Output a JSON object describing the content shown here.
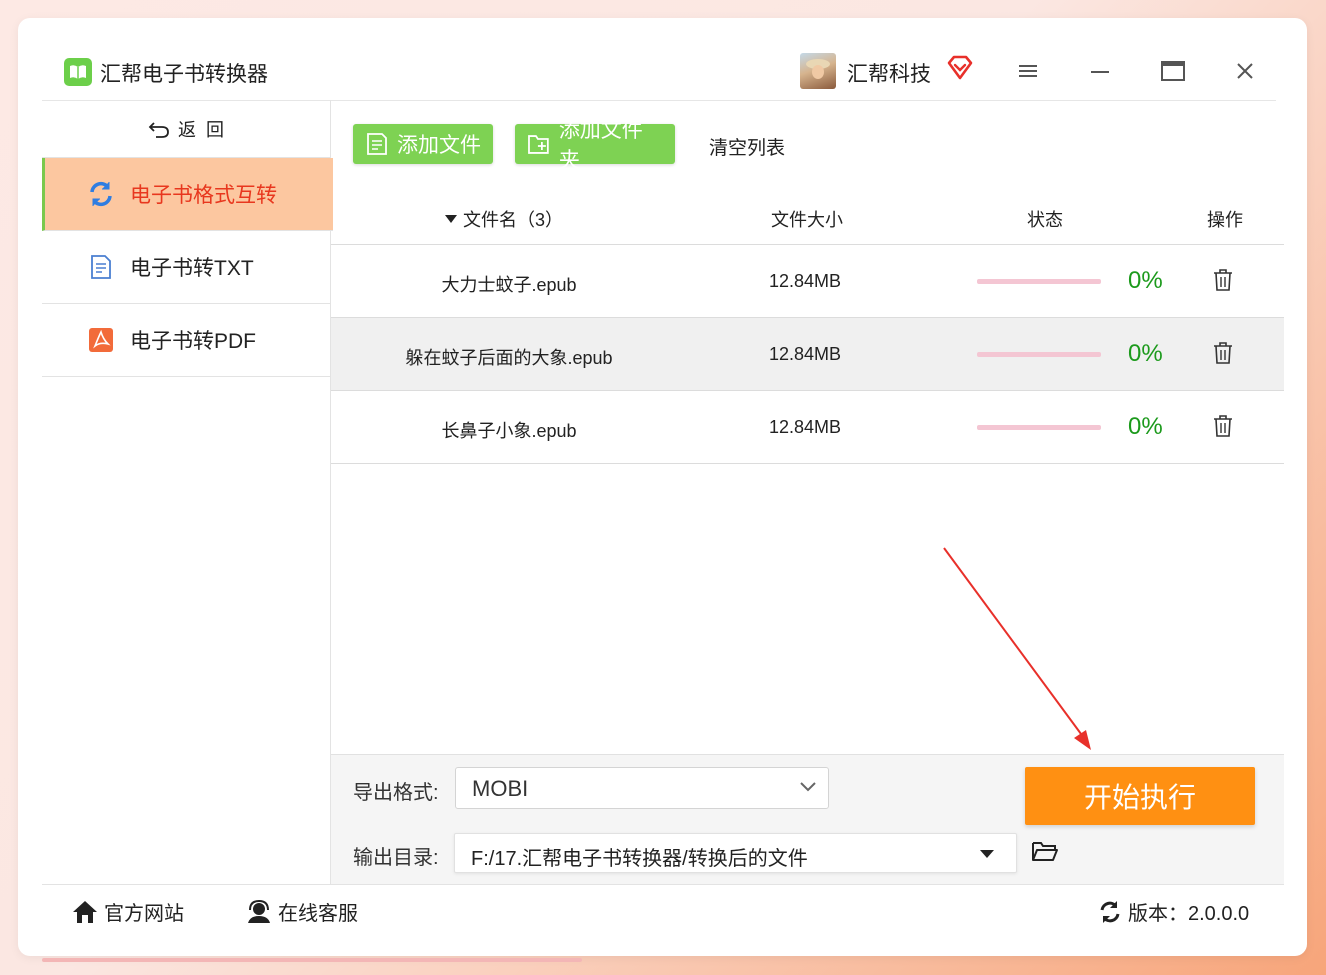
{
  "app": {
    "title": "汇帮电子书转换器",
    "company": "汇帮科技"
  },
  "sidebar": {
    "back_label": "返  回",
    "items": [
      {
        "label": "电子书格式互转",
        "icon": "refresh-icon",
        "active": true
      },
      {
        "label": "电子书转TXT",
        "icon": "document-icon",
        "active": false
      },
      {
        "label": "电子书转PDF",
        "icon": "pdf-icon",
        "active": false
      }
    ]
  },
  "toolbar": {
    "add_file": "添加文件",
    "add_folder": "添加文件夹",
    "clear_list": "清空列表"
  },
  "table": {
    "headers": {
      "name": "文件名（3）",
      "size": "文件大小",
      "status": "状态",
      "action": "操作"
    },
    "rows": [
      {
        "name": "大力士蚊子.epub",
        "size": "12.84MB",
        "progress": 0,
        "percent": "0%"
      },
      {
        "name": "躲在蚊子后面的大象.epub",
        "size": "12.84MB",
        "progress": 0,
        "percent": "0%"
      },
      {
        "name": "长鼻子小象.epub",
        "size": "12.84MB",
        "progress": 0,
        "percent": "0%"
      }
    ]
  },
  "options": {
    "format_label": "导出格式:",
    "format_value": "MOBI",
    "dir_label": "输出目录:",
    "dir_value": "F:/17.汇帮电子书转换器/转换后的文件",
    "start_label": "开始执行"
  },
  "footer": {
    "website": "官方网站",
    "support": "在线客服",
    "version": "版本：2.0.0.0"
  },
  "colors": {
    "accent_green": "#7ed253",
    "accent_orange": "#ff9012",
    "active_bg": "#fcc7a0",
    "active_text": "#e8371e",
    "percent": "#1c9a1c"
  }
}
